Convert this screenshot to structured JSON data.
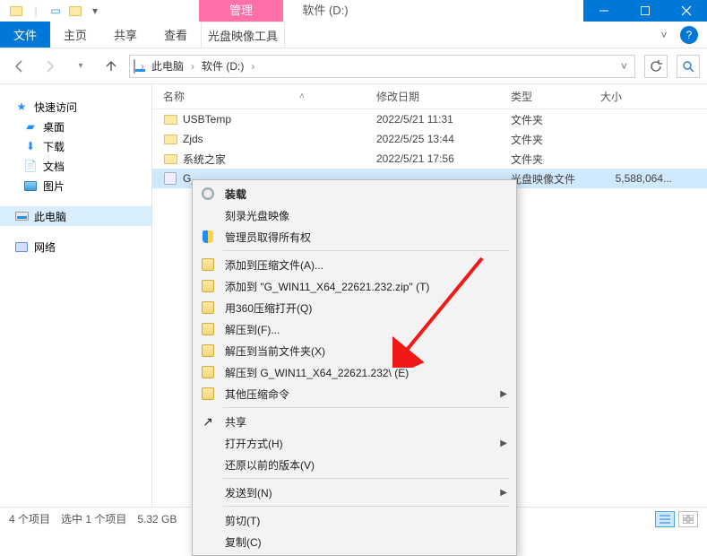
{
  "qat": {
    "context_group": "管理",
    "context_app": "软件 (D:)"
  },
  "ribbon": {
    "file": "文件",
    "home": "主页",
    "share": "共享",
    "view": "查看",
    "disc_tool": "光盘映像工具"
  },
  "addr": {
    "root": "此电脑",
    "drive": "软件 (D:)"
  },
  "columns": {
    "name": "名称",
    "date": "修改日期",
    "type": "类型",
    "size": "大小"
  },
  "sidebar": {
    "quick": "快速访问",
    "desktop": "桌面",
    "downloads": "下载",
    "documents": "文档",
    "pictures": "图片",
    "thispc": "此电脑",
    "network": "网络"
  },
  "rows": [
    {
      "name": "USBTemp",
      "date": "2022/5/21 11:31",
      "type": "文件夹",
      "size": ""
    },
    {
      "name": "Zjds",
      "date": "2022/5/25 13:44",
      "type": "文件夹",
      "size": ""
    },
    {
      "name": "系统之家",
      "date": "2022/5/21 17:56",
      "type": "文件夹",
      "size": ""
    },
    {
      "name": "G_",
      "date": "",
      "type": "光盘映像文件",
      "size": "5,588,064..."
    }
  ],
  "ctx": {
    "mount": "装载",
    "burn": "刻录光盘映像",
    "admin": "管理员取得所有权",
    "add_archive": "添加到压缩文件(A)...",
    "add_named": "添加到 \"G_WIN11_X64_22621.232.zip\" (T)",
    "open360": "用360压缩打开(Q)",
    "extract_to": "解压到(F)...",
    "extract_here": "解压到当前文件夹(X)",
    "extract_named": "解压到 G_WIN11_X64_22621.232\\ (E)",
    "other_compress": "其他压缩命令",
    "share": "共享",
    "open_with": "打开方式(H)",
    "restore_prev": "还原以前的版本(V)",
    "send_to": "发送到(N)",
    "cut": "剪切(T)",
    "copy": "复制(C)"
  },
  "status": {
    "count": "4 个项目",
    "selected": "选中 1 个项目",
    "size": "5.32 GB"
  }
}
